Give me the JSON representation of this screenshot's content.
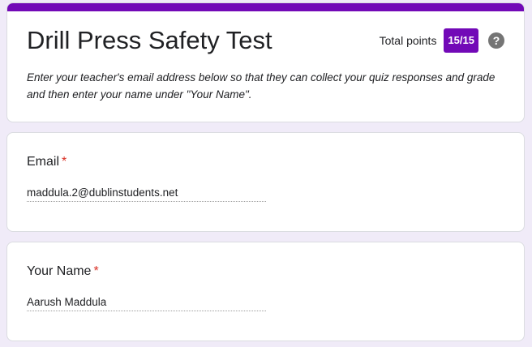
{
  "header": {
    "title": "Drill Press Safety Test",
    "points_label": "Total points",
    "points_value": "15/15",
    "help_icon": "help-circle-icon",
    "description": "Enter your teacher's email address below so that they can collect your quiz responses and grade and then enter your name under \"Your Name\".",
    "accent_color": "#7209b7"
  },
  "questions": [
    {
      "title": "Email",
      "required_marker": "*",
      "answer": "maddula.2@dublinstudents.net"
    },
    {
      "title": "Your Name",
      "required_marker": "*",
      "answer": "Aarush Maddula"
    }
  ]
}
